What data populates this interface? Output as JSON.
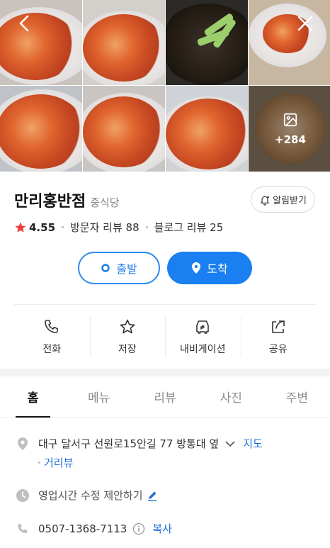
{
  "gallery": {
    "more_count": "+284"
  },
  "place": {
    "name": "만리홍반점",
    "category": "중식당",
    "notify_label": "알림받기",
    "rating": "4.55",
    "visitor_reviews": "방문자 리뷰 88",
    "blog_reviews": "블로그 리뷰 25"
  },
  "route": {
    "depart_label": "출발",
    "arrive_label": "도착"
  },
  "actions": [
    {
      "label": "전화",
      "icon": "phone-icon"
    },
    {
      "label": "저장",
      "icon": "star-icon"
    },
    {
      "label": "내비게이션",
      "icon": "navigation-icon"
    },
    {
      "label": "공유",
      "icon": "share-icon"
    }
  ],
  "tabs": [
    {
      "label": "홈",
      "active": true
    },
    {
      "label": "메뉴"
    },
    {
      "label": "리뷰"
    },
    {
      "label": "사진"
    },
    {
      "label": "주변"
    }
  ],
  "info": {
    "address": "대구 달서구 선원로15안길 77 방통대 옆",
    "map_link": "지도",
    "distance_link": "거리뷰",
    "hours": "영업시간 수정 제안하기",
    "phone": "0507-1368-7113",
    "copy_link": "복사"
  },
  "colors": {
    "accent": "#1a7ff0",
    "star": "#ef3d3d",
    "link": "#1f6fd9"
  }
}
